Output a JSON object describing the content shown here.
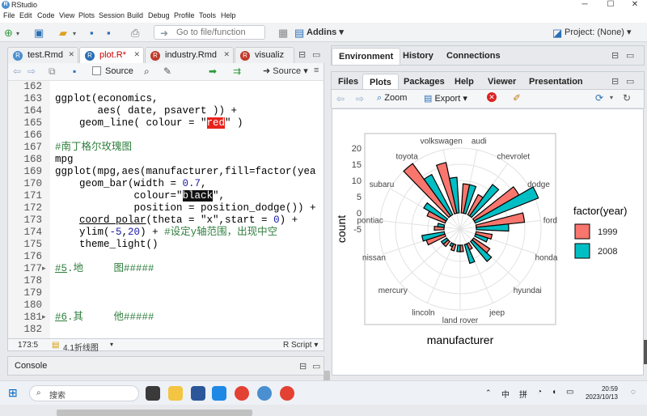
{
  "window": {
    "title": "RStudio"
  },
  "menu": [
    "File",
    "Edit",
    "Code",
    "View",
    "Plots",
    "Session",
    "Build",
    "Debug",
    "Profile",
    "Tools",
    "Help"
  ],
  "toolbar": {
    "goto_placeholder": "Go to file/function",
    "addins": "Addins",
    "project": "Project: (None)"
  },
  "editor": {
    "tabs": [
      "test.Rmd",
      "plot.R*",
      "industry.Rmd",
      "visualiz"
    ],
    "source_on_save": "Source",
    "source_btn": "Source",
    "lines": [
      {
        "n": "162",
        "fold": "",
        "html": ""
      },
      {
        "n": "163",
        "fold": "",
        "html": "ggplot(economics,"
      },
      {
        "n": "164",
        "fold": "",
        "html": "       aes( date, psavert )) +"
      },
      {
        "n": "165",
        "fold": "",
        "html": "    geom_line( colour = \"<span class='hl-red'>red</span>\" )"
      },
      {
        "n": "166",
        "fold": "",
        "html": ""
      },
      {
        "n": "167",
        "fold": "",
        "html": "<span class='cmt'>#南丁格尔玫瑰图</span>"
      },
      {
        "n": "168",
        "fold": "",
        "html": "mpg"
      },
      {
        "n": "169",
        "fold": "",
        "html": "ggplot(mpg,aes(manufacturer,fill=factor(yea"
      },
      {
        "n": "170",
        "fold": "",
        "html": "    geom_bar(width = <span class='num'>0.7</span>,"
      },
      {
        "n": "171",
        "fold": "",
        "html": "             colour=\"<span class='hl-black'>black</span>\","
      },
      {
        "n": "172",
        "fold": "",
        "html": "             position = position_dodge()) +"
      },
      {
        "n": "173",
        "fold": "",
        "html": "    <u>coord_polar</u>(theta = \"x\",start = <span class='num'>0</span>) +"
      },
      {
        "n": "174",
        "fold": "",
        "html": "    ylim(<span class='num'>-5</span>,<span class='num'>20</span>) + <span class='cmt'>#设定y轴范围，出现中空</span>"
      },
      {
        "n": "175",
        "fold": "",
        "html": "    theme_light()"
      },
      {
        "n": "176",
        "fold": "",
        "html": ""
      },
      {
        "n": "177",
        "fold": "▸",
        "html": "<span class='cmt'><u>#5</u>.地     图#####</span>"
      },
      {
        "n": "178",
        "fold": "",
        "html": ""
      },
      {
        "n": "179",
        "fold": "",
        "html": ""
      },
      {
        "n": "180",
        "fold": "",
        "html": ""
      },
      {
        "n": "181",
        "fold": "▸",
        "html": "<span class='cmt'><u>#6</u>.其     他#####</span>"
      },
      {
        "n": "182",
        "fold": "",
        "html": ""
      }
    ],
    "status_pos": "173:5",
    "status_section": "4.1折线图",
    "status_type": "R Script"
  },
  "console": {
    "label": "Console"
  },
  "env_tabs": [
    "Environment",
    "History",
    "Connections"
  ],
  "files_tabs": [
    "Files",
    "Plots",
    "Packages",
    "Help",
    "Viewer",
    "Presentation"
  ],
  "plots_toolbar": {
    "zoom": "Zoom",
    "export": "Export"
  },
  "chart_data": {
    "type": "bar",
    "subtype": "polar-dodged",
    "xlabel": "manufacturer",
    "ylabel": "count",
    "ylim": [
      -5,
      20
    ],
    "yticks": [
      "20",
      "15",
      "10",
      "5",
      "0",
      "-5"
    ],
    "legend_title": "factor(year)",
    "legend_position": "right",
    "categories": [
      "audi",
      "chevrolet",
      "dodge",
      "ford",
      "honda",
      "hyundai",
      "jeep",
      "land rover",
      "lincoln",
      "mercury",
      "nissan",
      "pontiac",
      "subaru",
      "toyota",
      "volkswagen"
    ],
    "series": [
      {
        "name": "1999",
        "color": "#f8766d",
        "values": [
          9,
          7,
          16,
          15,
          5,
          6,
          2,
          2,
          2,
          2,
          6,
          3,
          6,
          20,
          16
        ]
      },
      {
        "name": "2008",
        "color": "#00bfc4",
        "values": [
          9,
          12,
          21,
          10,
          4,
          8,
          6,
          2,
          1,
          2,
          7,
          2,
          8,
          14,
          11
        ]
      }
    ]
  },
  "taskbar": {
    "search": "搜索",
    "time": "20:59",
    "date": "2023/10/13",
    "ime1": "中",
    "ime2": "拼"
  }
}
